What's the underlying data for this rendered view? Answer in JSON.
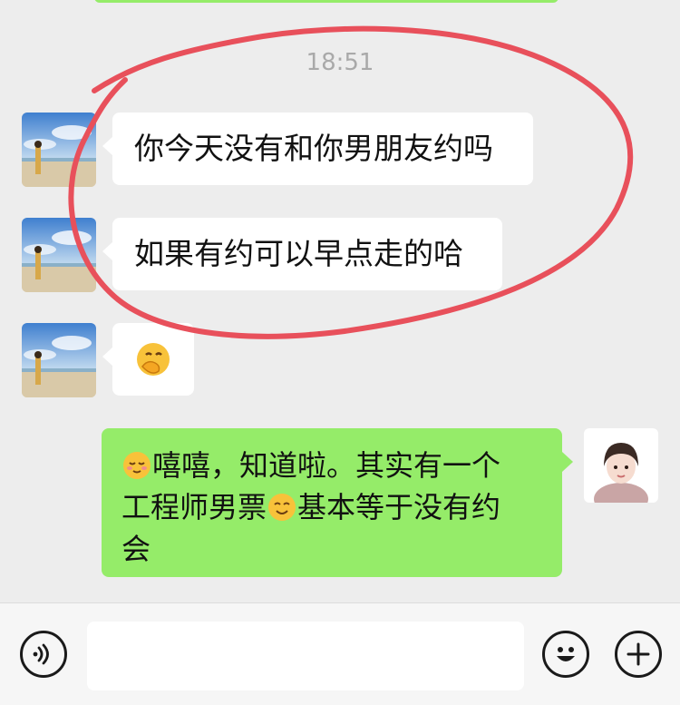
{
  "chat": {
    "timestamp": "18:51",
    "messages": [
      {
        "side": "left",
        "text": "你今天没有和你男朋友约吗"
      },
      {
        "side": "left",
        "text": "如果有约可以早点走的哈"
      },
      {
        "side": "left",
        "emoji": "face-with-hand-over-mouth-emoji"
      },
      {
        "side": "right",
        "line1": "嘻嘻，知道啦。其实有一个",
        "line2a": "工程师男票",
        "line2b": "基本等于没有约",
        "line3": "会"
      }
    ]
  },
  "input_bar": {
    "voice_icon": "voice-icon",
    "emoji_icon": "smiley-icon",
    "plus_icon": "plus-icon",
    "input_value": ""
  },
  "colors": {
    "background": "#ededed",
    "my_bubble": "#95ec69",
    "their_bubble": "#ffffff",
    "annotation_circle": "#e8505b"
  }
}
